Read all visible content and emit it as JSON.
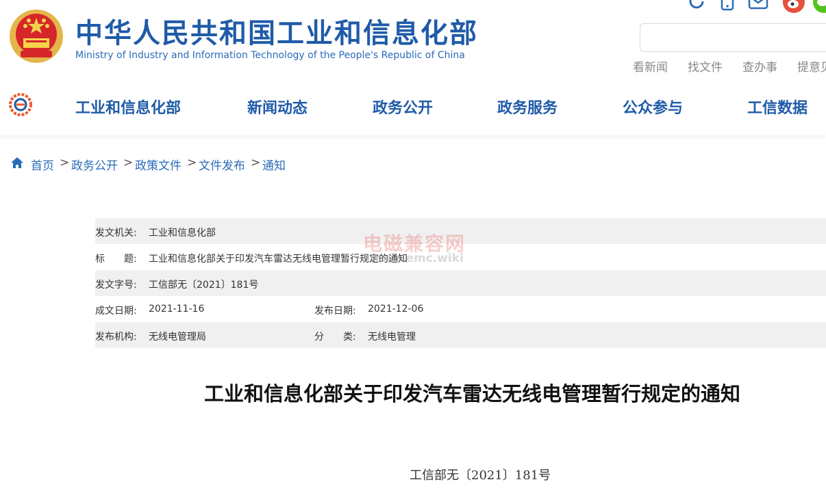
{
  "header": {
    "title_cn": "中华人民共和国工业和信息化部",
    "title_en": "Ministry of Industry and Information Technology of the People's Republic of China",
    "quick_links": [
      "看新闻",
      "找文件",
      "查办事",
      "提意见"
    ],
    "search_placeholder": ""
  },
  "nav": {
    "items": [
      "工业和信息化部",
      "新闻动态",
      "政务公开",
      "政务服务",
      "公众参与",
      "工信数据"
    ]
  },
  "breadcrumb": {
    "items": [
      "首页",
      "政务公开",
      "政策文件",
      "文件发布",
      "通知"
    ],
    "separator": ">"
  },
  "info": {
    "issuer_label": "发文机关:",
    "issuer": "工业和信息化部",
    "title_label": "标　　题:",
    "title": "工业和信息化部关于印发汽车雷达无线电管理暂行规定的通知",
    "doc_no_label": "发文字号:",
    "doc_no": "工信部无〔2021〕181号",
    "created_label": "成文日期:",
    "created": "2021-11-16",
    "published_label": "发布日期:",
    "published": "2021-12-06",
    "org_label": "发布机构:",
    "org": "无线电管理局",
    "category_label": "分　　类:",
    "category": "无线电管理"
  },
  "watermark": {
    "text_cn": "电磁兼容网",
    "url": "www.emc.wiki"
  },
  "document": {
    "title": "工业和信息化部关于印发汽车雷达无线电管理暂行规定的通知",
    "number": "工信部无〔2021〕181号"
  },
  "colors": {
    "brand_blue": "#1f5ba8",
    "link_blue": "#2a6bb8",
    "row_shade": "#f0f0f0",
    "weibo_red": "#e6503c",
    "wechat_green": "#52c41a"
  },
  "icons": [
    "refresh-icon",
    "mobile-icon",
    "mail-icon",
    "weibo-icon",
    "wechat-icon",
    "home-icon"
  ]
}
